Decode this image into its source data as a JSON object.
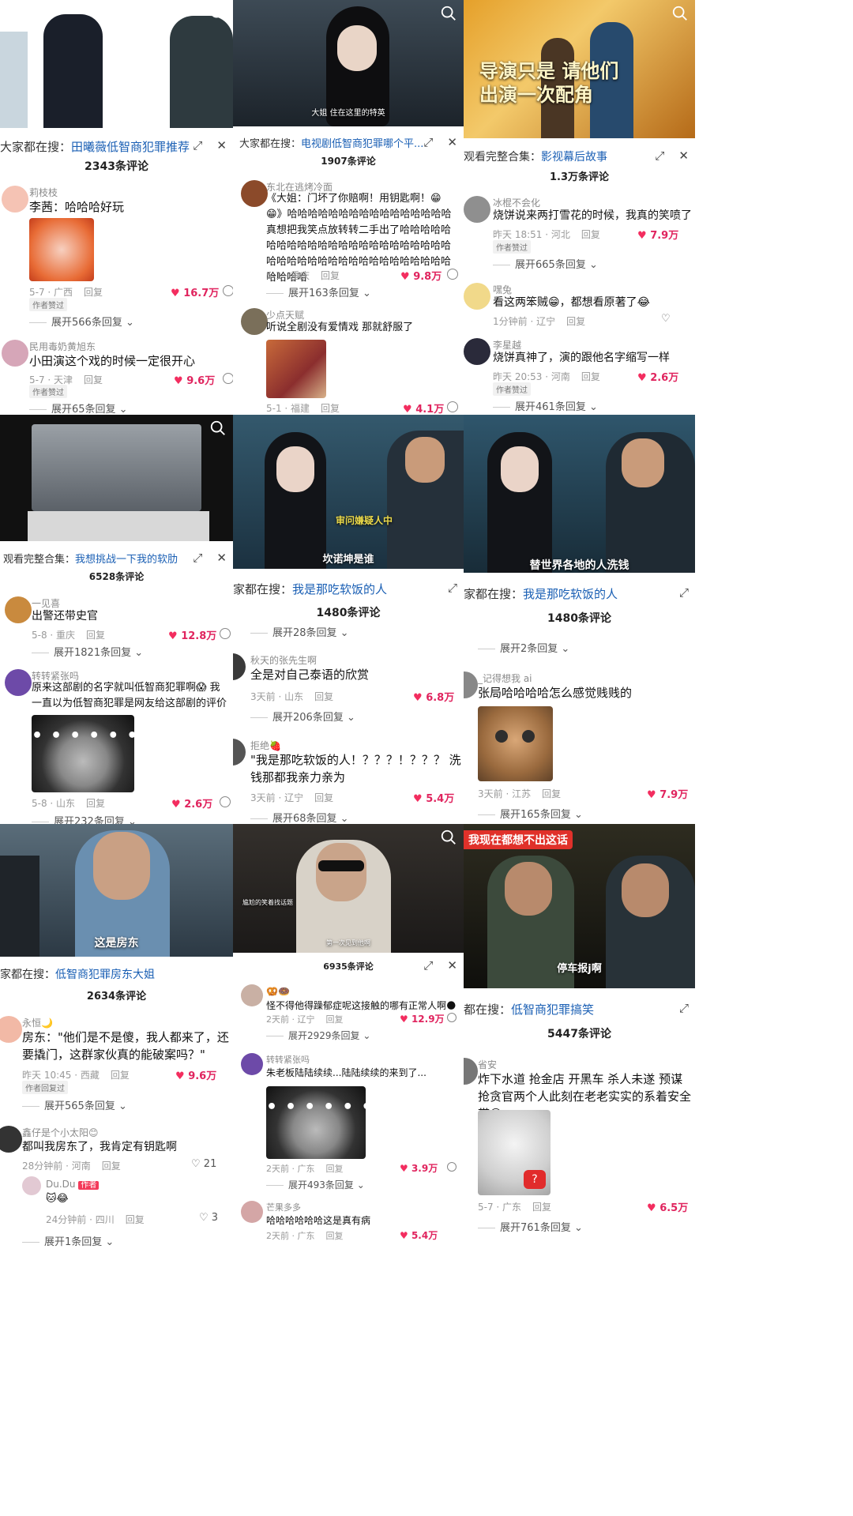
{
  "panels": [
    {
      "id": "p1",
      "caption": "",
      "header_prefix": "大家都在搜：",
      "header_keyword": "田曦薇低智商犯罪推荐",
      "count": "2343条评论",
      "comments": [
        {
          "user": "莉枝枝",
          "text": "李茜：哈哈哈好玩",
          "meta_date": "5-7 · 广西",
          "reply": "回复",
          "likes": "16.7万",
          "tag": "作者赞过"
        },
        {
          "user": "民用毒奶黄旭东",
          "text": "小田演这个戏的时候一定很开心",
          "meta_date": "5-7 · 天津",
          "reply": "回复",
          "likes": "9.6万",
          "tag": "作者赞过"
        }
      ],
      "expands": [
        "展开566条回复",
        "展开65条回复"
      ]
    },
    {
      "id": "p2",
      "caption": "大姐 住在这里的特英",
      "header_prefix": "大家都在搜：",
      "header_keyword": "电视剧低智商犯罪哪个平...",
      "count": "1907条评论",
      "comments": [
        {
          "user": "东北在逃烤冷面",
          "text": "《大姐：门坏了你赔啊！用钥匙啊！😁😁》哈哈哈哈哈哈哈哈哈哈哈哈哈哈哈哈真想把我笑点放转转二手出了哈哈哈哈哈哈哈哈哈哈哈哈哈哈哈哈哈哈哈哈哈哈哈哈哈哈哈哈哈哈哈哈哈哈哈哈哈哈哈哈哈哈哈哈哈",
          "meta_date": "5-1 · 重庆",
          "reply": "回复",
          "likes": "9.8万"
        },
        {
          "user": "少点天赋",
          "text": "听说全剧没有爱情戏 那就舒服了",
          "meta_date": "5-1 · 福建",
          "reply": "回复",
          "likes": "4.1万"
        }
      ],
      "expands": [
        "展开163条回复"
      ]
    },
    {
      "id": "p3",
      "caption": "导演只是 请他们 出演一次配角",
      "header_prefix": "观看完整合集：",
      "header_keyword": "影视幕后故事",
      "count": "1.3万条评论",
      "comments": [
        {
          "user": "冰棍不会化",
          "text": "烧饼说来两打雪花的时候，我真的笑喷了",
          "meta_date": "昨天 18:51 · 河北",
          "reply": "回复",
          "likes": "7.9万",
          "tag": "作者赞过"
        },
        {
          "user": "嘿兔",
          "text": "看这两笨贼😁，都想看原著了😂",
          "meta_date": "1分钟前 · 辽宁",
          "reply": "回复",
          "likes": ""
        },
        {
          "user": "李星越",
          "text": "烧饼真神了，演的跟他名字缩写一样",
          "meta_date": "昨天 20:53 · 河南",
          "reply": "回复",
          "likes": "2.6万",
          "tag": "作者赞过"
        }
      ],
      "expands": [
        "展开665条回复",
        "展开461条回复"
      ]
    },
    {
      "id": "p4",
      "caption": "",
      "header_prefix": "观看完整合集：",
      "header_keyword": "我想挑战一下我的软肋",
      "count": "6528条评论",
      "comments": [
        {
          "user": "一见喜",
          "text": "出警还带史官",
          "meta_date": "5-8 · 重庆",
          "reply": "回复",
          "likes": "12.8万"
        },
        {
          "user": "转转紧张吗",
          "text": "原来这部剧的名字就叫低智商犯罪啊😱 我一直以为低智商犯罪是网友给这部剧的评价",
          "meta_date": "5-8 · 山东",
          "reply": "回复",
          "likes": "2.6万"
        }
      ],
      "expands": [
        "展开1821条回复",
        "展开232条回复"
      ]
    },
    {
      "id": "p5",
      "caption": "坎诺坤是谁",
      "caption2": "审问嫌疑人中",
      "header_prefix": "家都在搜：",
      "header_keyword": "我是那吃软饭的人",
      "count": "1480条评论",
      "comments": [
        {
          "user": "秋天的张先生啊",
          "text": "全是对自己泰语的欣赏",
          "meta_date": "3天前 · 山东",
          "reply": "回复",
          "likes": "6.8万"
        },
        {
          "user": "拒绝🍓",
          "text": "\"我是那吃软饭的人！？？？！？？？ 洗钱那都我亲力亲为的！！！！！！！......\"",
          "meta_date": "3天前 · 辽宁",
          "reply": "回复",
          "likes": "5.4万"
        }
      ],
      "expands": [
        "展开28条回复",
        "展开206条回复",
        "展开68条回复"
      ]
    },
    {
      "id": "p6",
      "caption": "替世界各地的人洗钱",
      "header_prefix": "家都在搜：",
      "header_keyword": "我是那吃软饭的人",
      "count": "1480条评论",
      "comments": [
        {
          "user": "_记得想我 ai",
          "text": "张局哈哈哈哈怎么感觉贱贱的",
          "meta_date": "3天前 · 江苏",
          "reply": "回复",
          "likes": "7.9万"
        }
      ],
      "expands": [
        "展开2条回复",
        "展开165条回复"
      ]
    },
    {
      "id": "p7",
      "caption": "这是房东",
      "header_prefix": "家都在搜：",
      "header_keyword": "低智商犯罪房东大姐",
      "count": "2634条评论",
      "comments": [
        {
          "user": "永恒🌙",
          "text": "房东：\"他们是不是傻，我人都来了，还要撬门，这群家伙真的能破案吗？\"",
          "meta_date": "昨天 10:45 · 西藏",
          "reply": "回复",
          "likes": "9.6万",
          "tag": "作者回复过"
        },
        {
          "user": "鑫仔是个小太阳😊",
          "text": "都叫我房东了，我肯定有钥匙啊",
          "meta_date": "28分钟前 · 河南",
          "reply": "回复",
          "likes": "21"
        },
        {
          "user": "Du.Du",
          "user_tag": "作者",
          "text": "🐱😂",
          "meta_date": "24分钟前 · 四川",
          "reply": "回复",
          "likes": "3"
        }
      ],
      "expands": [
        "展开565条回复",
        "展开1条回复"
      ]
    },
    {
      "id": "p8",
      "caption": "第一次见到他啊",
      "caption2": "尴尬的笑着找话题",
      "header_prefix": "",
      "header_keyword": "",
      "count": "6935条评论",
      "comments": [
        {
          "user": "🥨🍩",
          "text": "怪不得他得躁郁症呢这接触的哪有正常人啊🌑",
          "meta_date": "2天前 · 辽宁",
          "reply": "回复",
          "likes": "12.9万"
        },
        {
          "user": "转转紧张吗",
          "text": "朱老板陆陆续续...陆陆续续的来到了...",
          "meta_date": "2天前 · 广东",
          "reply": "回复",
          "likes": "3.9万"
        },
        {
          "user": "芒果多多",
          "text": "哈哈哈哈哈哈这是真有病",
          "meta_date": "2天前 · 广东",
          "reply": "回复",
          "likes": "5.4万"
        }
      ],
      "expands": [
        "展开2929条回复",
        "展开493条回复"
      ]
    },
    {
      "id": "p9",
      "caption": "停车报j啊",
      "banner": "我现在都想不出这话",
      "header_prefix": "都在搜：",
      "header_keyword": "低智商犯罪搞笑",
      "count": "5447条评论",
      "comments": [
        {
          "user": "省安",
          "text": "炸下水道 抢金店 开黑车 杀人未遂 预谋抢贪官两个人此刻在老老实实的系着安全带😏",
          "meta_date": "5-7 · 广东",
          "reply": "回复",
          "likes": "6.5万"
        }
      ],
      "expands": [
        "展开761条回复"
      ]
    }
  ]
}
